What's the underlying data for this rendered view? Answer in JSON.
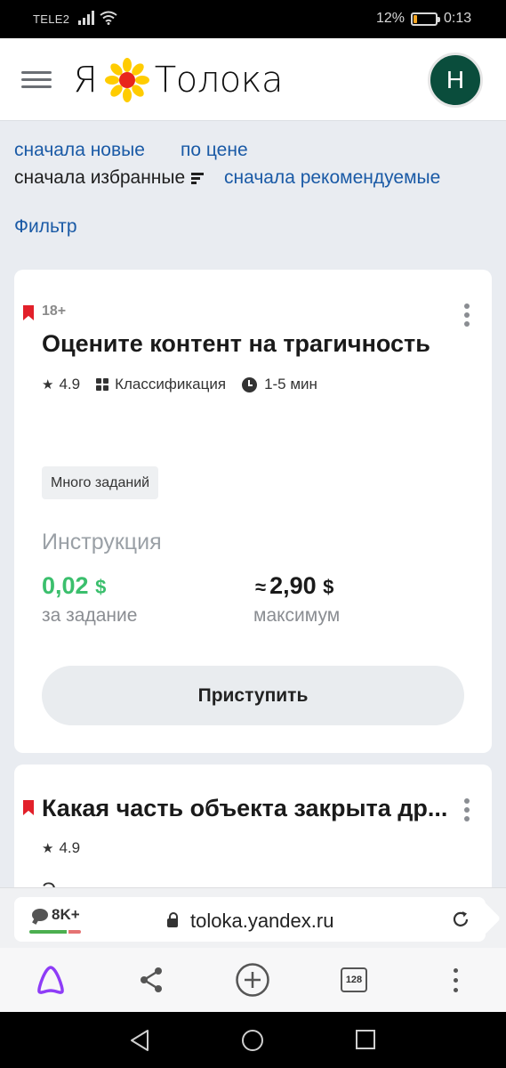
{
  "status_bar": {
    "carrier": "TELE2",
    "battery_percent": "12%",
    "time": "0:13"
  },
  "header": {
    "logo_ya": "Я",
    "logo_name": "Толока",
    "avatar_letter": "Н"
  },
  "sorting": {
    "newest": "сначала новые",
    "by_price": "по цене",
    "favorites_first": "сначала избранные",
    "recommended_first": "сначала рекомендуемые",
    "filter": "Фильтр"
  },
  "tasks": [
    {
      "age_badge": "18+",
      "title": "Оцените контент на трагичность",
      "rating": "4.9",
      "type": "Классификация",
      "duration": "1-5 мин",
      "tag": "Много заданий",
      "instruction": "Инструкция",
      "price_per_task": "0,02",
      "price_per_task_label": "за задание",
      "approx_sign": "≈",
      "max_price": "2,90",
      "max_price_label": "максимум",
      "currency": "$",
      "action": "Приступить"
    },
    {
      "title": "Какая часть объекта закрыта др...",
      "rating": "4.9",
      "partial_line": "Э"
    }
  ],
  "browser": {
    "comments_count": "8K+",
    "url": "toloka.yandex.ru",
    "tabs_count": "128",
    "rating_positive_fraction": 0.75
  },
  "colors": {
    "link": "#1a5aa6",
    "price_green": "#3bbf6d",
    "bookmark_red": "#e2202a",
    "avatar_bg": "#0a4d3c",
    "alice_purple": "#8e3cf7"
  }
}
